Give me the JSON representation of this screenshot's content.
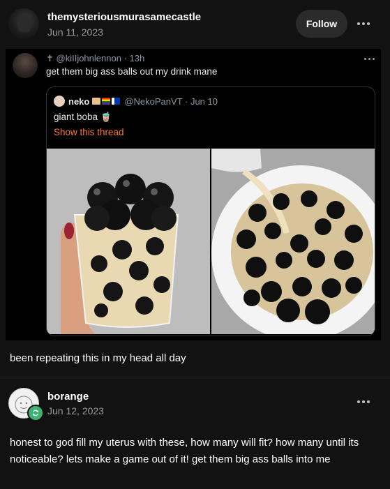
{
  "post": {
    "author": "themysteriousmurasamecastle",
    "date": "Jun 11, 2023",
    "follow_label": "Follow",
    "caption": "been repeating this in my head all day"
  },
  "tweet": {
    "meta": "✝ @kiIIjohnlennon · 13h",
    "text": "get them big ass balls out my drink mane",
    "quote": {
      "name": "neko",
      "handle_date": "@NekoPanVT · Jun 10",
      "text": "giant boba 🧋",
      "link": "Show this thread"
    }
  },
  "reply": {
    "author": "borange",
    "date": "Jun 12, 2023",
    "text": "honest to god fill my uterus with these, how many will fit? how many until its noticeable? lets make a game out of it! get them big ass balls into me"
  },
  "colors": {
    "background": "#121212",
    "link_orange": "#f97a2e",
    "reblog_green": "#3cb371"
  }
}
